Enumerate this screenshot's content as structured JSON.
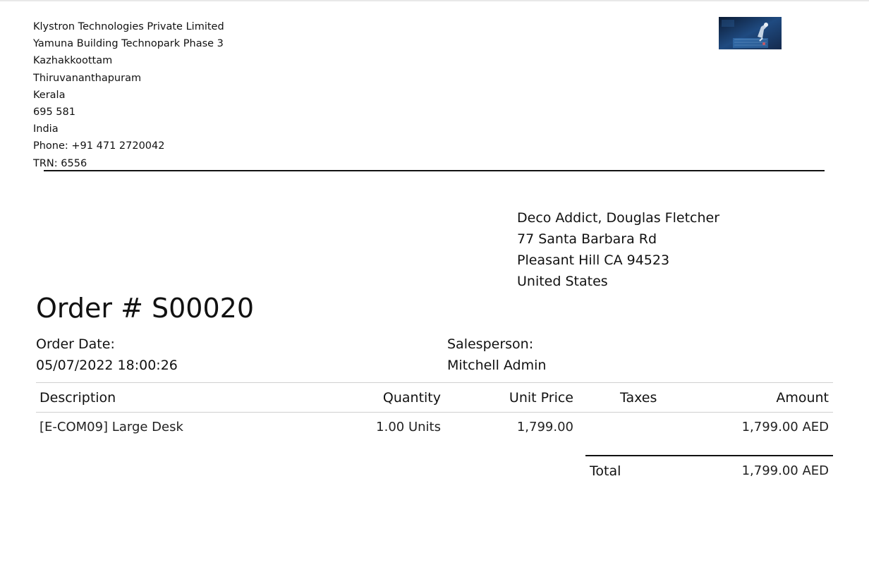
{
  "company": {
    "lines": [
      "Klystron Technologies Private Limited",
      "Yamuna Building Technopark Phase 3",
      "Kazhakkoottam",
      "Thiruvananthapuram",
      "Kerala",
      "695 581",
      "India",
      "Phone: +91 471 2720042",
      "TRN: 6556"
    ]
  },
  "customer": {
    "lines": [
      "Deco Addict, Douglas Fletcher",
      "77 Santa Barbara Rd",
      "Pleasant Hill CA 94523",
      "United States"
    ]
  },
  "order": {
    "title": "Order # S00020",
    "date_label": "Order Date:",
    "date_value": "05/07/2022 18:00:26",
    "salesperson_label": "Salesperson:",
    "salesperson_value": "Mitchell Admin"
  },
  "table": {
    "headers": {
      "description": "Description",
      "quantity": "Quantity",
      "unit_price": "Unit Price",
      "taxes": "Taxes",
      "amount": "Amount"
    },
    "rows": [
      {
        "description": "[E-COM09] Large Desk",
        "quantity": "1.00 Units",
        "unit_price": "1,799.00",
        "taxes": "",
        "amount": "1,799.00 AED"
      }
    ]
  },
  "totals": {
    "label": "Total",
    "value": "1,799.00 AED"
  },
  "logo": {
    "icon": "company-logo-image",
    "colors": [
      "#0d1f3c",
      "#2f6aa6",
      "#c9d6e6"
    ]
  }
}
